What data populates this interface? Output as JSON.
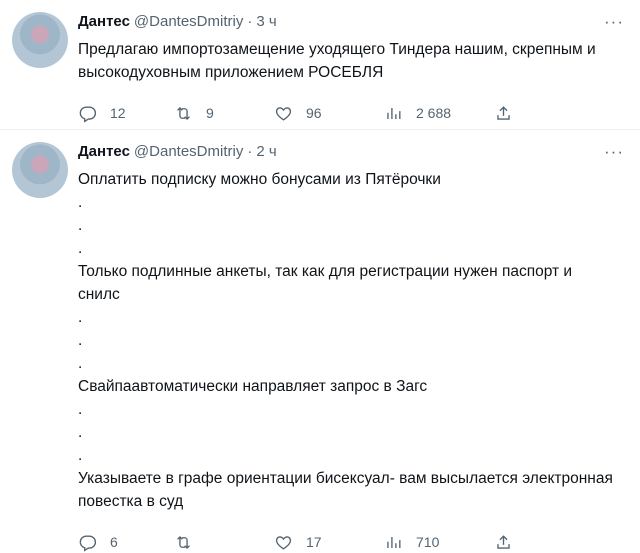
{
  "tweets": [
    {
      "name": "Дантес",
      "handle": "@DantesDmitriy",
      "time": "3 ч",
      "text_lines": [
        "Предлагаю импортозамещение уходящего Тиндера нашим, скрепным и",
        "высокодуховным приложением РОСЕБЛЯ"
      ],
      "replies": "12",
      "retweets": "9",
      "likes": "96",
      "views": "2 688"
    },
    {
      "name": "Дантес",
      "handle": "@DantesDmitriy",
      "time": "2 ч",
      "text_lines": [
        "Оплатить подписку можно бонусами из Пятёрочки",
        ".",
        ".",
        ".",
        "Только подлинные анкеты, так как для регистрации нужен паспорт и",
        "снилс",
        ".",
        ".",
        ".",
        "Свайпаавтоматически направляет запрос в Загс",
        ".",
        ".",
        ".",
        "Указываете в графе ориентации бисексуал- вам высылается электронная",
        "повестка в суд"
      ],
      "replies": "6",
      "retweets": "",
      "likes": "17",
      "views": "710"
    }
  ],
  "dot_sep": "·",
  "more_glyph": "···"
}
